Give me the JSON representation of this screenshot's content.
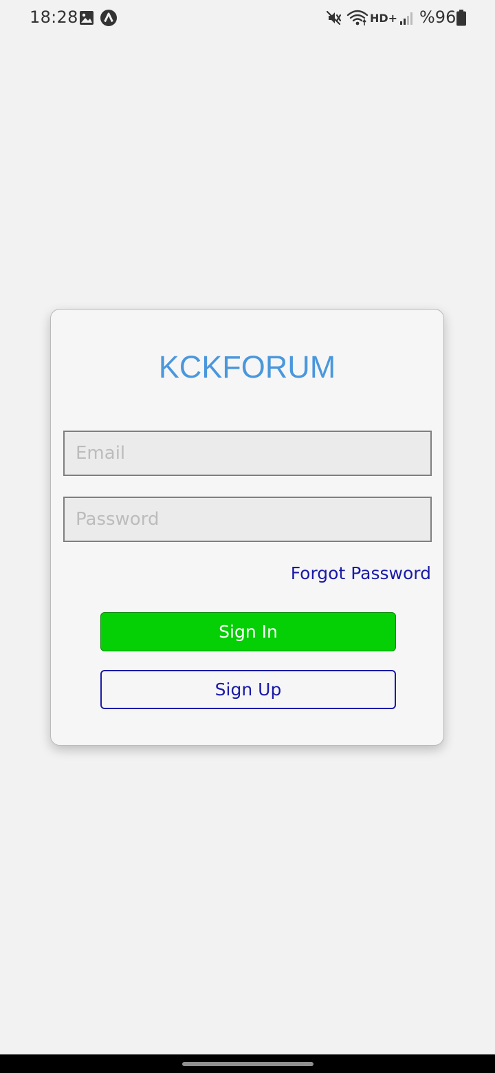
{
  "status_bar": {
    "time": "18:28",
    "battery_percent": "%96",
    "network_label": "HD+",
    "icons": [
      "image-icon",
      "app-a-icon",
      "vibrate-mute-icon",
      "wifi-icon",
      "signal-icon",
      "battery-icon"
    ]
  },
  "login": {
    "title": "KCKFORUM",
    "email_placeholder": "Email",
    "password_placeholder": "Password",
    "forgot_password_label": "Forgot Password",
    "sign_in_label": "Sign In",
    "sign_up_label": "Sign Up"
  },
  "colors": {
    "background": "#f2f2f2",
    "title": "#4a97dc",
    "link": "#1a1aa8",
    "sign_in_button": "#05cf05"
  }
}
